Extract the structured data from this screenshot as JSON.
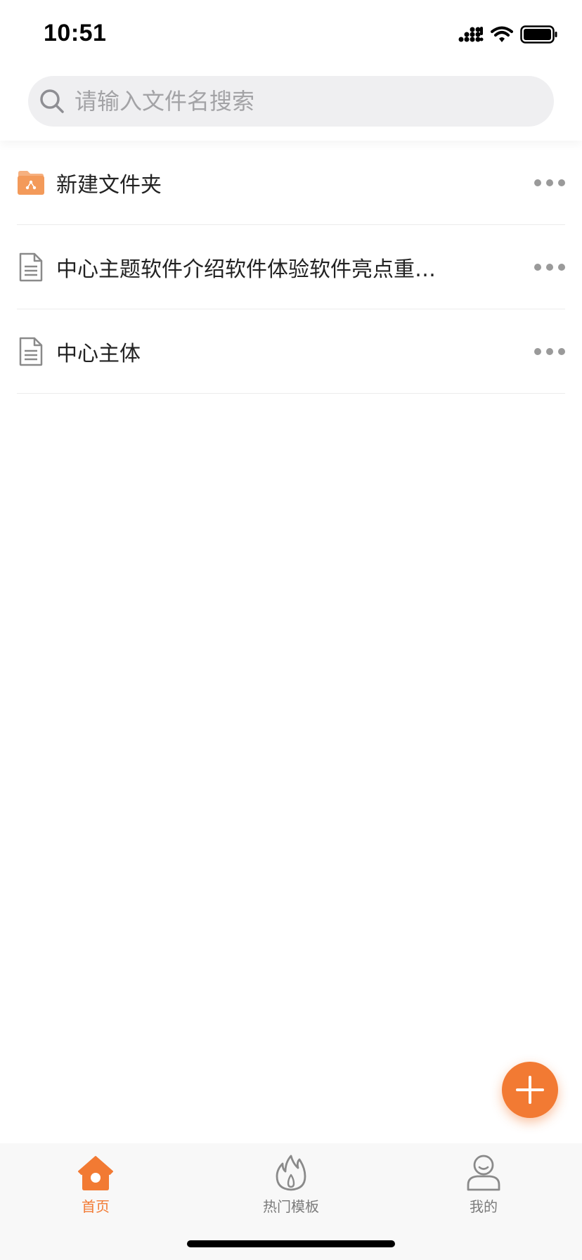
{
  "status_bar": {
    "time": "10:51"
  },
  "search": {
    "placeholder": "请输入文件名搜索",
    "value": ""
  },
  "files": [
    {
      "name": "新建文件夹",
      "icon": "folder-icon"
    },
    {
      "name": "中心主题软件介绍软件体验软件亮点重…",
      "icon": "document-icon"
    },
    {
      "name": "中心主体",
      "icon": "document-icon"
    }
  ],
  "tabs": {
    "home": {
      "label": "首页",
      "icon": "home-icon",
      "active": true
    },
    "templates": {
      "label": "热门模板",
      "icon": "flame-icon",
      "active": false
    },
    "mine": {
      "label": "我的",
      "icon": "user-icon",
      "active": false
    }
  },
  "colors": {
    "accent": "#f27a33",
    "search_bg": "#efeff1",
    "tab_bar_bg": "#f8f8f8",
    "inactive_tab": "#7b7b7b"
  }
}
